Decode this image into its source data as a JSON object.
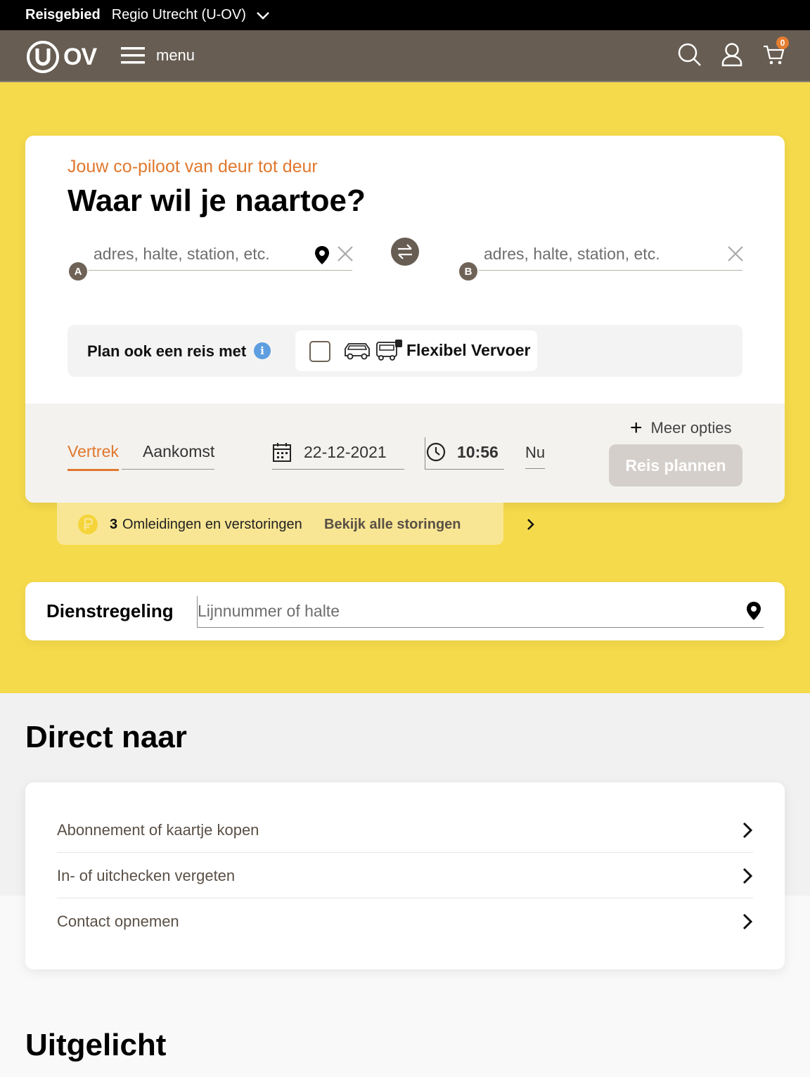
{
  "topbar": {
    "label": "Reisgebied",
    "region": "Regio Utrecht (U-OV)"
  },
  "header": {
    "logo_text": "OV",
    "menu_label": "menu",
    "cart_count": "0"
  },
  "planner": {
    "tagline": "Jouw co-piloot van deur tot deur",
    "title": "Waar wil je naartoe?",
    "from": {
      "marker": "A",
      "placeholder": "adres, halte, station, etc."
    },
    "to": {
      "marker": "B",
      "placeholder": "adres, halte, station, etc."
    },
    "plan_also_label": "Plan ook een reis met",
    "info_symbol": "i",
    "flex_label": "Flexibel Vervoer",
    "tabs": {
      "depart": "Vertrek",
      "arrive": "Aankomst"
    },
    "date": "22-12-2021",
    "time": "10:56",
    "now": "Nu",
    "more_options": "Meer opties",
    "submit": "Reis plannen"
  },
  "disruptions": {
    "count": "3",
    "text": "Omleidingen en verstoringen",
    "link": "Bekijk alle storingen"
  },
  "timetable": {
    "label": "Dienstregeling",
    "placeholder": "Lijnnummer of halte"
  },
  "direct": {
    "heading": "Direct naar",
    "items": [
      {
        "label": "Abonnement of kaartje kopen"
      },
      {
        "label": "In- of uitchecken vergeten"
      },
      {
        "label": "Contact opnemen"
      }
    ]
  },
  "featured": {
    "heading": "Uitgelicht"
  },
  "colors": {
    "accent": "#e0782e",
    "hero": "#f5da4b",
    "brand": "#675d52"
  }
}
